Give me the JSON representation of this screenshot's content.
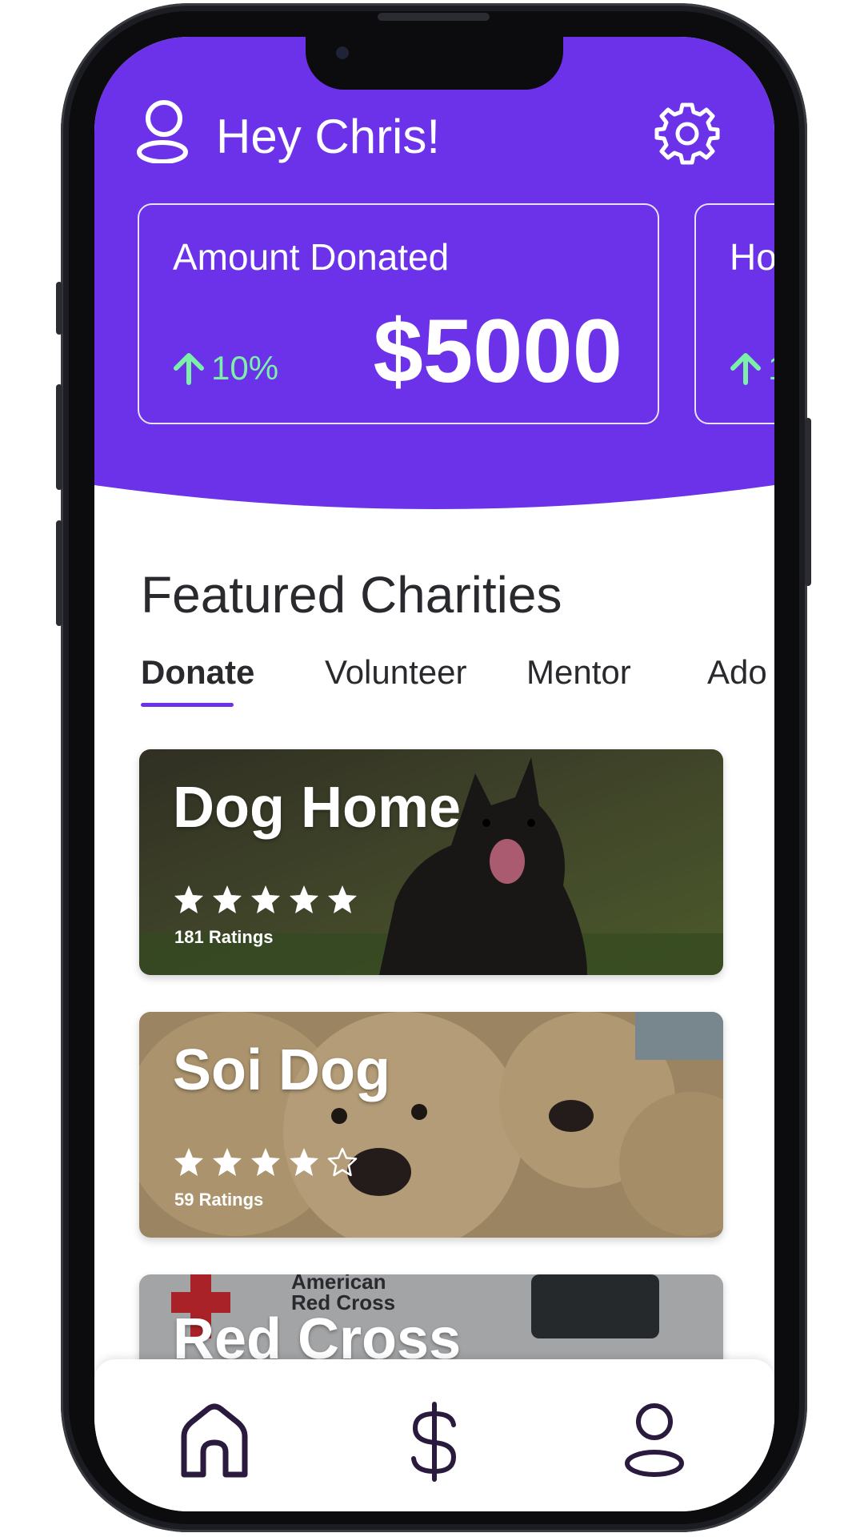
{
  "colors": {
    "brand_purple": "#6b32ea",
    "positive_green": "#7cf0a6",
    "nav_icon": "#2a1a3d"
  },
  "header": {
    "greeting": "Hey Chris!",
    "user_icon": "user-icon",
    "settings_icon": "gear-icon"
  },
  "stats": [
    {
      "label": "Amount Donated",
      "value": "$5000",
      "change": "10%",
      "change_icon": "arrow-up-icon"
    },
    {
      "label": "Ho",
      "value": "",
      "change": "1",
      "change_icon": "arrow-up-icon"
    }
  ],
  "featured": {
    "title": "Featured Charities",
    "tabs": [
      "Donate",
      "Volunteer",
      "Mentor",
      "Ado"
    ],
    "active_tab": "Donate"
  },
  "charities": [
    {
      "name": "Dog Home",
      "rating": 5,
      "max_rating": 5,
      "ratings_text": "181 Ratings"
    },
    {
      "name": "Soi Dog",
      "rating": 4,
      "max_rating": 5,
      "ratings_text": "59 Ratings"
    },
    {
      "name": "Red Cross",
      "image_text": "American Red Cross"
    }
  ],
  "bottom_nav": {
    "items": [
      "home-icon",
      "dollar-icon",
      "profile-icon"
    ],
    "active": "home-icon"
  }
}
